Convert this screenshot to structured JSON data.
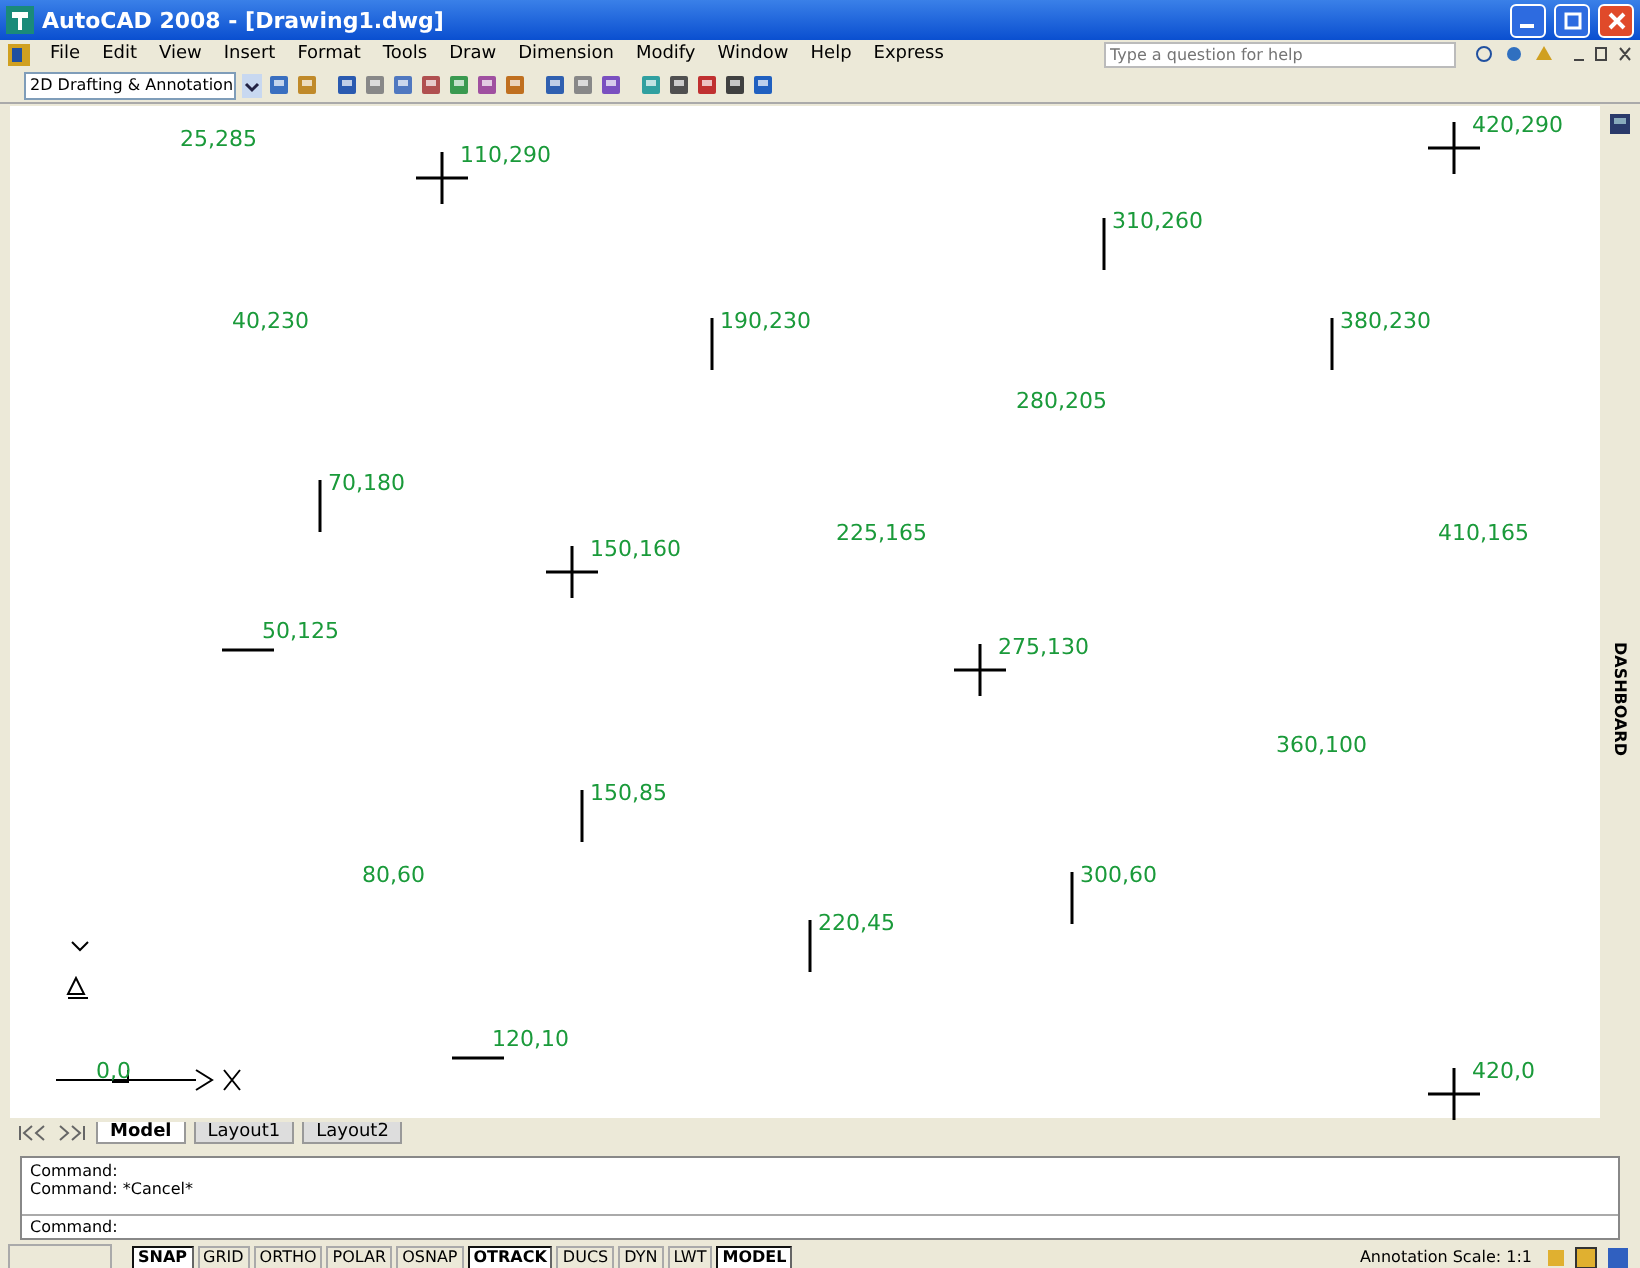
{
  "window": {
    "title": "AutoCAD 2008 - [Drawing1.dwg]"
  },
  "menu": [
    "File",
    "Edit",
    "View",
    "Insert",
    "Format",
    "Tools",
    "Draw",
    "Dimension",
    "Modify",
    "Window",
    "Help",
    "Express"
  ],
  "toolbar": {
    "workspace": "2D Drafting & Annotation"
  },
  "help_search": {
    "placeholder": "Type a question for help"
  },
  "drawing": {
    "points": [
      {
        "label": "25,285",
        "kind": "none"
      },
      {
        "label": "110,290",
        "kind": "cross"
      },
      {
        "label": "420,290",
        "kind": "cross"
      },
      {
        "label": "310,260",
        "kind": "vline"
      },
      {
        "label": "40,230",
        "kind": "none"
      },
      {
        "label": "190,230",
        "kind": "vline"
      },
      {
        "label": "380,230",
        "kind": "vline"
      },
      {
        "label": "280,205",
        "kind": "none"
      },
      {
        "label": "70,180",
        "kind": "vline"
      },
      {
        "label": "150,160",
        "kind": "cross"
      },
      {
        "label": "225,165",
        "kind": "none"
      },
      {
        "label": "410,165",
        "kind": "none"
      },
      {
        "label": "50,125",
        "kind": "hline"
      },
      {
        "label": "275,130",
        "kind": "cross"
      },
      {
        "label": "360,100",
        "kind": "none"
      },
      {
        "label": "150,85",
        "kind": "vline"
      },
      {
        "label": "80,60",
        "kind": "none"
      },
      {
        "label": "300,60",
        "kind": "vline"
      },
      {
        "label": "220,45",
        "kind": "vline"
      },
      {
        "label": "120,10",
        "kind": "hline"
      },
      {
        "label": "0,0",
        "kind": "origin"
      },
      {
        "label": "420,0",
        "kind": "cross"
      }
    ]
  },
  "dashboard": {
    "label": "DASHBOARD"
  },
  "layout_tabs": [
    {
      "label": "Model",
      "selected": true
    },
    {
      "label": "Layout1",
      "selected": false
    },
    {
      "label": "Layout2",
      "selected": false
    }
  ],
  "command": {
    "history": [
      "Command:",
      "Command: *Cancel*"
    ],
    "prompt": "Command:"
  },
  "status_bar": {
    "toggles": [
      {
        "label": "SNAP",
        "on": true
      },
      {
        "label": "GRID",
        "on": false
      },
      {
        "label": "ORTHO",
        "on": false
      },
      {
        "label": "POLAR",
        "on": false
      },
      {
        "label": "OSNAP",
        "on": false
      },
      {
        "label": "OTRACK",
        "on": true
      },
      {
        "label": "DUCS",
        "on": false
      },
      {
        "label": "DYN",
        "on": false
      },
      {
        "label": "LWT",
        "on": false
      },
      {
        "label": "MODEL",
        "on": true
      }
    ],
    "annotation_scale": "Annotation Scale: 1:1"
  }
}
